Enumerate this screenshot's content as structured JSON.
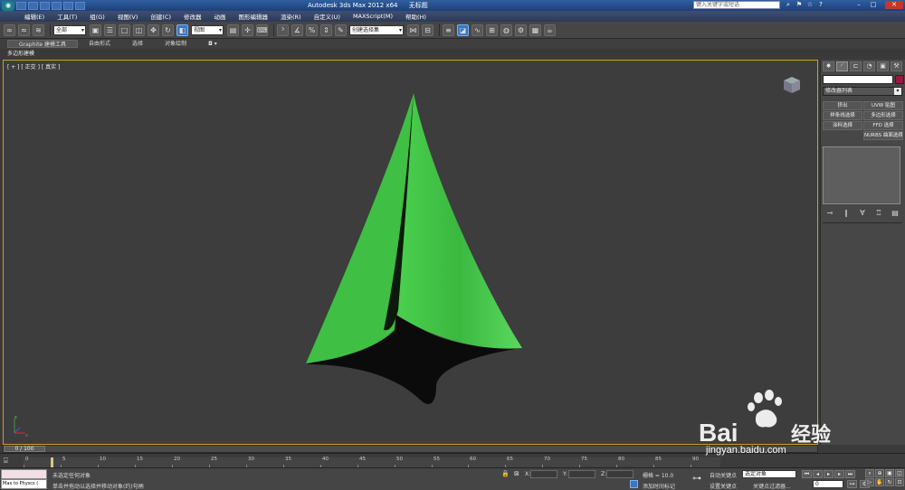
{
  "window": {
    "title_parts": [
      "Autodesk 3ds Max  2012 x64",
      "无标题"
    ],
    "search_placeholder": "键入关键字或短语"
  },
  "menu": [
    "编辑(E)",
    "工具(T)",
    "组(G)",
    "视图(V)",
    "创建(C)",
    "修改器",
    "动画",
    "图形编辑器",
    "渲染(R)",
    "自定义(U)",
    "MAXScript(M)",
    "帮助(H)"
  ],
  "toolbar": {
    "selection_filter": "全部",
    "ref_coord": "视图",
    "named_sel": "创建选择集"
  },
  "ribbon": {
    "tabs": [
      "Graphite 建模工具",
      "自由形式",
      "选择",
      "对象绘制"
    ],
    "sub_label": "多边形建模"
  },
  "viewport": {
    "label": "[ + ] [ 正交 ] [ 真实 ]",
    "object_color": "#4bd14f"
  },
  "command_panel": {
    "modifier_list": "修改器列表",
    "buttons": [
      "挤出",
      "UVW 贴图",
      "样条线选择",
      "多边形选择",
      "涂料选择",
      "FFD 选择",
      "",
      "NURBS 曲面选择"
    ]
  },
  "timeline": {
    "slider_label": "0 / 100",
    "ticks": [
      "0",
      "5",
      "10",
      "15",
      "20",
      "25",
      "30",
      "35",
      "40",
      "45",
      "50",
      "55",
      "60",
      "65",
      "70",
      "75",
      "80",
      "85",
      "90"
    ]
  },
  "statusbar": {
    "maxscript_text": "Max to Physcs (",
    "status_line1": "未选定任何对象",
    "status_line2": "单击并拖动以选择并移动对象(约)句柄",
    "x_label": "X:",
    "y_label": "Y:",
    "z_label": "Z:",
    "grid": "栅格 = 10.0",
    "add_time_tag": "添加时间标记",
    "auto_key": "自动关键点",
    "set_key": "设置关键点",
    "key_filter": "关键点过滤器...",
    "selected_object": "选定对象",
    "frame_value": "0"
  },
  "watermark": {
    "brand": "Bai 经验",
    "url": "jingyan.baidu.com"
  }
}
